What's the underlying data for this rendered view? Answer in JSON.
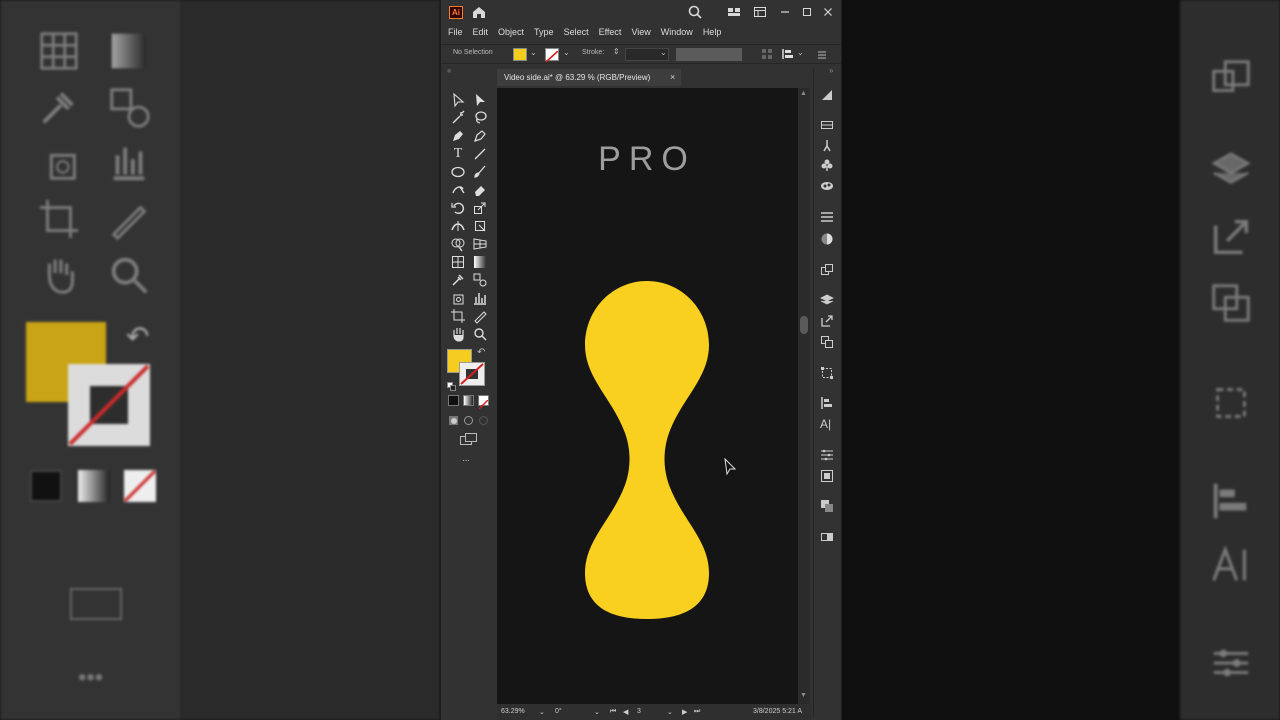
{
  "app": {
    "logo_text": "Ai",
    "menu": [
      "File",
      "Edit",
      "Object",
      "Type",
      "Select",
      "Effect",
      "View",
      "Window",
      "Help"
    ]
  },
  "control_bar": {
    "selection_label": "No Selection",
    "stroke_label": "Stroke:",
    "fill_color": "#f5cc20"
  },
  "document": {
    "tab_title": "Video side.ai* @ 63.29 % (RGB/Preview)",
    "close_glyph": "×",
    "artboard_text": "PRO",
    "shape_color": "#f9d01f",
    "canvas_color": "#151515"
  },
  "status_bar": {
    "zoom": "63.29%",
    "rotation": "0°",
    "artboard_number": "3",
    "datetime": "3/8/2025  5:21 A"
  },
  "toolbar": {
    "more_glyph": "···",
    "fill_color": "#f5cc20"
  },
  "icons": {
    "titlebar": [
      "home-icon",
      "search-icon",
      "arrange-icon",
      "panel-icon",
      "minimize-icon",
      "maximize-icon",
      "close-icon"
    ],
    "right_panel": [
      "gradient-icon",
      "properties-icon",
      "brushes-icon",
      "symbols-icon",
      "graphic-styles-icon",
      "stroke-icon",
      "transparency-icon",
      "libraries-icon",
      "layers-icon",
      "export-icon",
      "artboards-icon",
      "transform-icon",
      "align-icon",
      "character-icon",
      "paragraph-icon",
      "navigator-icon",
      "pathfinder-icon",
      "color-guide-icon"
    ]
  }
}
